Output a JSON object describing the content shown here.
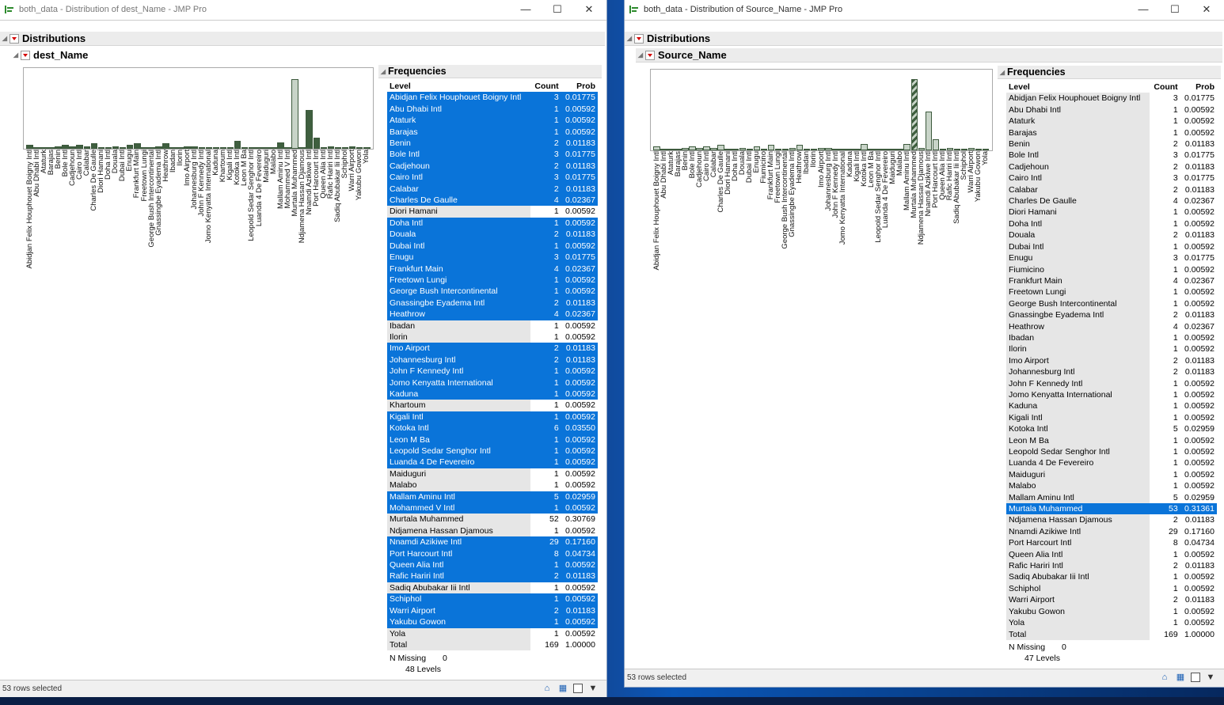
{
  "left_window": {
    "title": "both_data - Distribution of dest_Name - JMP Pro",
    "outline_title": "Distributions",
    "var_title": "dest_Name",
    "freq_title": "Frequencies",
    "col_level": "Level",
    "col_count": "Count",
    "col_prob": "Prob",
    "missing_label": "N Missing",
    "missing_value": "0",
    "levels_text": "48  Levels",
    "status_text": "53 rows selected",
    "rows": [
      {
        "level": "Abidjan Felix Houphouet Boigny Intl",
        "count": "3",
        "prob": "0.01775",
        "sel": true
      },
      {
        "level": "Abu Dhabi Intl",
        "count": "1",
        "prob": "0.00592",
        "sel": true
      },
      {
        "level": "Ataturk",
        "count": "1",
        "prob": "0.00592",
        "sel": true
      },
      {
        "level": "Barajas",
        "count": "1",
        "prob": "0.00592",
        "sel": true
      },
      {
        "level": "Benin",
        "count": "2",
        "prob": "0.01183",
        "sel": true
      },
      {
        "level": "Bole Intl",
        "count": "3",
        "prob": "0.01775",
        "sel": true
      },
      {
        "level": "Cadjehoun",
        "count": "2",
        "prob": "0.01183",
        "sel": true
      },
      {
        "level": "Cairo Intl",
        "count": "3",
        "prob": "0.01775",
        "sel": true
      },
      {
        "level": "Calabar",
        "count": "2",
        "prob": "0.01183",
        "sel": true
      },
      {
        "level": "Charles De Gaulle",
        "count": "4",
        "prob": "0.02367",
        "sel": true
      },
      {
        "level": "Diori Hamani",
        "count": "1",
        "prob": "0.00592",
        "sel": false
      },
      {
        "level": "Doha Intl",
        "count": "1",
        "prob": "0.00592",
        "sel": true
      },
      {
        "level": "Douala",
        "count": "2",
        "prob": "0.01183",
        "sel": true
      },
      {
        "level": "Dubai Intl",
        "count": "1",
        "prob": "0.00592",
        "sel": true
      },
      {
        "level": "Enugu",
        "count": "3",
        "prob": "0.01775",
        "sel": true
      },
      {
        "level": "Frankfurt Main",
        "count": "4",
        "prob": "0.02367",
        "sel": true
      },
      {
        "level": "Freetown Lungi",
        "count": "1",
        "prob": "0.00592",
        "sel": true
      },
      {
        "level": "George Bush Intercontinental",
        "count": "1",
        "prob": "0.00592",
        "sel": true
      },
      {
        "level": "Gnassingbe Eyadema Intl",
        "count": "2",
        "prob": "0.01183",
        "sel": true
      },
      {
        "level": "Heathrow",
        "count": "4",
        "prob": "0.02367",
        "sel": true
      },
      {
        "level": "Ibadan",
        "count": "1",
        "prob": "0.00592",
        "sel": false
      },
      {
        "level": "Ilorin",
        "count": "1",
        "prob": "0.00592",
        "sel": false
      },
      {
        "level": "Imo Airport",
        "count": "2",
        "prob": "0.01183",
        "sel": true
      },
      {
        "level": "Johannesburg Intl",
        "count": "2",
        "prob": "0.01183",
        "sel": true
      },
      {
        "level": "John F Kennedy Intl",
        "count": "1",
        "prob": "0.00592",
        "sel": true
      },
      {
        "level": "Jomo Kenyatta International",
        "count": "1",
        "prob": "0.00592",
        "sel": true
      },
      {
        "level": "Kaduna",
        "count": "1",
        "prob": "0.00592",
        "sel": true
      },
      {
        "level": "Khartoum",
        "count": "1",
        "prob": "0.00592",
        "sel": false
      },
      {
        "level": "Kigali Intl",
        "count": "1",
        "prob": "0.00592",
        "sel": true
      },
      {
        "level": "Kotoka Intl",
        "count": "6",
        "prob": "0.03550",
        "sel": true
      },
      {
        "level": "Leon M Ba",
        "count": "1",
        "prob": "0.00592",
        "sel": true
      },
      {
        "level": "Leopold Sedar Senghor Intl",
        "count": "1",
        "prob": "0.00592",
        "sel": true
      },
      {
        "level": "Luanda 4 De Fevereiro",
        "count": "1",
        "prob": "0.00592",
        "sel": true
      },
      {
        "level": "Maiduguri",
        "count": "1",
        "prob": "0.00592",
        "sel": false
      },
      {
        "level": "Malabo",
        "count": "1",
        "prob": "0.00592",
        "sel": false
      },
      {
        "level": "Mallam Aminu Intl",
        "count": "5",
        "prob": "0.02959",
        "sel": true
      },
      {
        "level": "Mohammed V Intl",
        "count": "1",
        "prob": "0.00592",
        "sel": true
      },
      {
        "level": "Murtala Muhammed",
        "count": "52",
        "prob": "0.30769",
        "sel": false
      },
      {
        "level": "Ndjamena Hassan Djamous",
        "count": "1",
        "prob": "0.00592",
        "sel": false
      },
      {
        "level": "Nnamdi Azikiwe Intl",
        "count": "29",
        "prob": "0.17160",
        "sel": true
      },
      {
        "level": "Port Harcourt Intl",
        "count": "8",
        "prob": "0.04734",
        "sel": true
      },
      {
        "level": "Queen Alia Intl",
        "count": "1",
        "prob": "0.00592",
        "sel": true
      },
      {
        "level": "Rafic Hariri Intl",
        "count": "2",
        "prob": "0.01183",
        "sel": true
      },
      {
        "level": "Sadiq Abubakar Iii Intl",
        "count": "1",
        "prob": "0.00592",
        "sel": false
      },
      {
        "level": "Schiphol",
        "count": "1",
        "prob": "0.00592",
        "sel": true
      },
      {
        "level": "Warri Airport",
        "count": "2",
        "prob": "0.01183",
        "sel": true
      },
      {
        "level": "Yakubu Gowon",
        "count": "1",
        "prob": "0.00592",
        "sel": true
      },
      {
        "level": "Yola",
        "count": "1",
        "prob": "0.00592",
        "sel": false
      },
      {
        "level": "Total",
        "count": "169",
        "prob": "1.00000",
        "sel": false,
        "total": true
      }
    ]
  },
  "right_window": {
    "title": "both_data - Distribution of Source_Name - JMP Pro",
    "outline_title": "Distributions",
    "var_title": "Source_Name",
    "freq_title": "Frequencies",
    "col_level": "Level",
    "col_count": "Count",
    "col_prob": "Prob",
    "missing_label": "N Missing",
    "missing_value": "0",
    "levels_text": "47  Levels",
    "status_text": "53 rows selected",
    "rows": [
      {
        "level": "Abidjan Felix Houphouet Boigny Intl",
        "count": "3",
        "prob": "0.01775",
        "sel": false
      },
      {
        "level": "Abu Dhabi Intl",
        "count": "1",
        "prob": "0.00592",
        "sel": false
      },
      {
        "level": "Ataturk",
        "count": "1",
        "prob": "0.00592",
        "sel": false
      },
      {
        "level": "Barajas",
        "count": "1",
        "prob": "0.00592",
        "sel": false
      },
      {
        "level": "Benin",
        "count": "2",
        "prob": "0.01183",
        "sel": false
      },
      {
        "level": "Bole Intl",
        "count": "3",
        "prob": "0.01775",
        "sel": false
      },
      {
        "level": "Cadjehoun",
        "count": "2",
        "prob": "0.01183",
        "sel": false
      },
      {
        "level": "Cairo Intl",
        "count": "3",
        "prob": "0.01775",
        "sel": false
      },
      {
        "level": "Calabar",
        "count": "2",
        "prob": "0.01183",
        "sel": false
      },
      {
        "level": "Charles De Gaulle",
        "count": "4",
        "prob": "0.02367",
        "sel": false
      },
      {
        "level": "Diori Hamani",
        "count": "1",
        "prob": "0.00592",
        "sel": false
      },
      {
        "level": "Doha Intl",
        "count": "1",
        "prob": "0.00592",
        "sel": false
      },
      {
        "level": "Douala",
        "count": "2",
        "prob": "0.01183",
        "sel": false
      },
      {
        "level": "Dubai Intl",
        "count": "1",
        "prob": "0.00592",
        "sel": false
      },
      {
        "level": "Enugu",
        "count": "3",
        "prob": "0.01775",
        "sel": false
      },
      {
        "level": "Fiumicino",
        "count": "1",
        "prob": "0.00592",
        "sel": false
      },
      {
        "level": "Frankfurt Main",
        "count": "4",
        "prob": "0.02367",
        "sel": false
      },
      {
        "level": "Freetown Lungi",
        "count": "1",
        "prob": "0.00592",
        "sel": false
      },
      {
        "level": "George Bush Intercontinental",
        "count": "1",
        "prob": "0.00592",
        "sel": false
      },
      {
        "level": "Gnassingbe Eyadema Intl",
        "count": "2",
        "prob": "0.01183",
        "sel": false
      },
      {
        "level": "Heathrow",
        "count": "4",
        "prob": "0.02367",
        "sel": false
      },
      {
        "level": "Ibadan",
        "count": "1",
        "prob": "0.00592",
        "sel": false
      },
      {
        "level": "Ilorin",
        "count": "1",
        "prob": "0.00592",
        "sel": false
      },
      {
        "level": "Imo Airport",
        "count": "2",
        "prob": "0.01183",
        "sel": false
      },
      {
        "level": "Johannesburg Intl",
        "count": "2",
        "prob": "0.01183",
        "sel": false
      },
      {
        "level": "John F Kennedy Intl",
        "count": "1",
        "prob": "0.00592",
        "sel": false
      },
      {
        "level": "Jomo Kenyatta International",
        "count": "1",
        "prob": "0.00592",
        "sel": false
      },
      {
        "level": "Kaduna",
        "count": "1",
        "prob": "0.00592",
        "sel": false
      },
      {
        "level": "Kigali Intl",
        "count": "1",
        "prob": "0.00592",
        "sel": false
      },
      {
        "level": "Kotoka Intl",
        "count": "5",
        "prob": "0.02959",
        "sel": false
      },
      {
        "level": "Leon M Ba",
        "count": "1",
        "prob": "0.00592",
        "sel": false
      },
      {
        "level": "Leopold Sedar Senghor Intl",
        "count": "1",
        "prob": "0.00592",
        "sel": false
      },
      {
        "level": "Luanda 4 De Fevereiro",
        "count": "1",
        "prob": "0.00592",
        "sel": false
      },
      {
        "level": "Maiduguri",
        "count": "1",
        "prob": "0.00592",
        "sel": false
      },
      {
        "level": "Malabo",
        "count": "1",
        "prob": "0.00592",
        "sel": false
      },
      {
        "level": "Mallam Aminu Intl",
        "count": "5",
        "prob": "0.02959",
        "sel": false
      },
      {
        "level": "Murtala Muhammed",
        "count": "53",
        "prob": "0.31361",
        "sel": true
      },
      {
        "level": "Ndjamena Hassan Djamous",
        "count": "2",
        "prob": "0.01183",
        "sel": false
      },
      {
        "level": "Nnamdi Azikiwe Intl",
        "count": "29",
        "prob": "0.17160",
        "sel": false
      },
      {
        "level": "Port Harcourt Intl",
        "count": "8",
        "prob": "0.04734",
        "sel": false
      },
      {
        "level": "Queen Alia Intl",
        "count": "1",
        "prob": "0.00592",
        "sel": false
      },
      {
        "level": "Rafic Hariri Intl",
        "count": "2",
        "prob": "0.01183",
        "sel": false
      },
      {
        "level": "Sadiq Abubakar Iii Intl",
        "count": "1",
        "prob": "0.00592",
        "sel": false
      },
      {
        "level": "Schiphol",
        "count": "1",
        "prob": "0.00592",
        "sel": false
      },
      {
        "level": "Warri Airport",
        "count": "2",
        "prob": "0.01183",
        "sel": false
      },
      {
        "level": "Yakubu Gowon",
        "count": "1",
        "prob": "0.00592",
        "sel": false
      },
      {
        "level": "Yola",
        "count": "1",
        "prob": "0.00592",
        "sel": false
      },
      {
        "level": "Total",
        "count": "169",
        "prob": "1.00000",
        "sel": false,
        "total": true
      }
    ]
  },
  "colors": {
    "selection": "#0a74d9",
    "bar": "#c8d4c8",
    "bar_selected": "#3f5f3f"
  },
  "icons": {
    "app": "jmp-app-icon",
    "minimize": "minimize-icon",
    "maximize": "maximize-icon",
    "close": "close-icon"
  }
}
